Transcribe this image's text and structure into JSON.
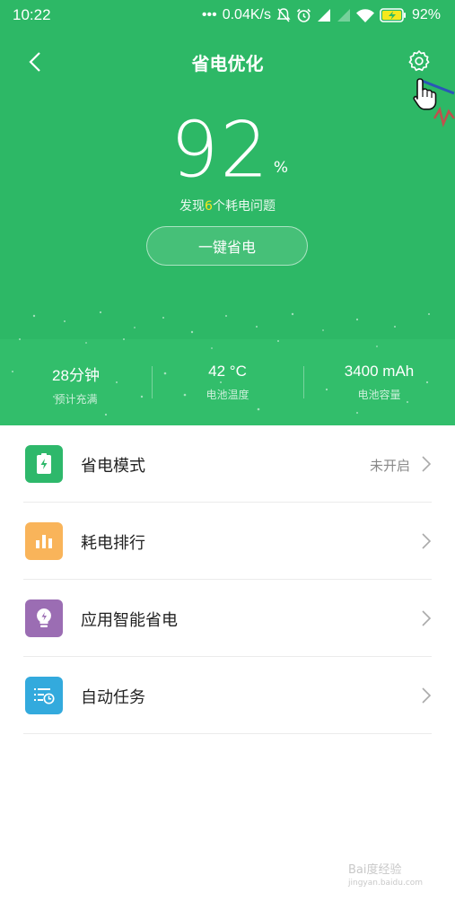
{
  "status_bar": {
    "time": "10:22",
    "signal_dots": "•••",
    "net_speed": "0.04K/s",
    "battery_pct": "92%"
  },
  "header": {
    "title": "省电优化",
    "back_icon": "back-arrow-icon",
    "settings_icon": "gear-icon"
  },
  "battery": {
    "percent": "92",
    "unit": "%",
    "issues_prefix": "发现",
    "issues_count": "6",
    "issues_suffix": "个耗电问题",
    "button_label": "一键省电"
  },
  "stats": [
    {
      "value": "28分钟",
      "label": "预计充满"
    },
    {
      "value": "42 °C",
      "label": "电池温度"
    },
    {
      "value": "3400 mAh",
      "label": "电池容量"
    }
  ],
  "menu": [
    {
      "label": "省电模式",
      "status": "未开启",
      "icon": "battery-bolt-icon",
      "color": "#2eb86b"
    },
    {
      "label": "耗电排行",
      "status": "",
      "icon": "bar-chart-icon",
      "color": "#f9b45a"
    },
    {
      "label": "应用智能省电",
      "status": "",
      "icon": "lightbulb-icon",
      "color": "#9b6db3"
    },
    {
      "label": "自动任务",
      "status": "",
      "icon": "task-clock-icon",
      "color": "#33aadd"
    }
  ],
  "watermark": {
    "text": "Bai度经验",
    "sub": "jingyan.baidu.com"
  },
  "colors": {
    "green": "#2db866",
    "green_stats": "#32be6b",
    "highlight": "#f6e81e"
  }
}
